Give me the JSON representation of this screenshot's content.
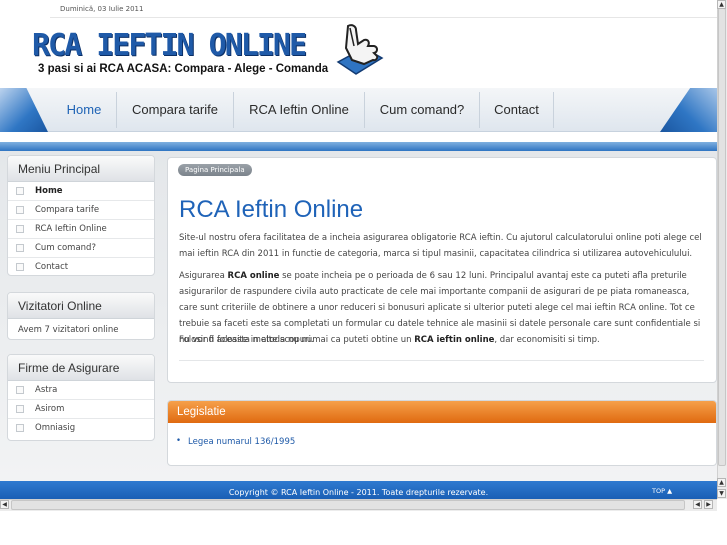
{
  "header": {
    "date": "Duminică, 03 Iulie 2011",
    "logo_title": "RCA IEFTIN ONLINE",
    "logo_subtitle": "3 pasi si ai RCA ACASA: Compara - Alege - Comanda"
  },
  "nav": {
    "items": [
      {
        "label": "Home",
        "active": true
      },
      {
        "label": "Compara tarife"
      },
      {
        "label": "RCA Ieftin Online"
      },
      {
        "label": "Cum comand?"
      },
      {
        "label": "Contact"
      }
    ]
  },
  "sidebar": {
    "menu": {
      "title": "Meniu Principal",
      "items": [
        "Home",
        "Compara tarife",
        "RCA Ieftin Online",
        "Cum comand?",
        "Contact"
      ]
    },
    "visitors": {
      "title": "Vizitatori Online",
      "text": "Avem 7 vizitatori online"
    },
    "insurers": {
      "title": "Firme de Asigurare",
      "items": [
        "Astra",
        "Asirom",
        "Omniasig"
      ]
    }
  },
  "content": {
    "breadcrumb": "Pagina Principala",
    "title": "RCA Ieftin Online",
    "p1": "Site-ul nostru ofera facilitatea de a incheia asigurarea obligatorie RCA ieftin. Cu ajutorul calculatorului online poti alege cel mai ieftin RCA din 2011 in functie de categoria, marca si tipul masinii, capacitatea cilindrica si utilizarea autovehiculului.",
    "p2_a": "Asigurarea ",
    "p2_b": "RCA online",
    "p2_c": " se poate incheia pe o perioada de 6 sau 12 luni. Principalul avantaj este ca puteti afla preturile asigurarilor de raspundere civila auto practicate de cele mai importante companii de asigurari de pe piata romaneasca, care sunt criteriile de obtinere a unor reduceri si bonusuri aplicate si ulterior puteti alege cel mai ieftin RCA online. Tot ce trebuie sa faceti este sa completati un formular cu datele tehnice ale masinii si datele personale care sunt confidentiale si nu vor fi folosite in alte scopuri.",
    "p3_a": "Folosind aceasta metoda nu numai ca puteti obtine un ",
    "p3_b": "RCA ieftin online",
    "p3_c": ", dar economisiti si timp."
  },
  "legislation": {
    "title": "Legislatie",
    "items": [
      "Legea numarul 136/1995"
    ]
  },
  "footer": {
    "copyright": "Copyright © RCA Ieftin Online - 2011. Toate drepturile rezervate.",
    "top_link": "TOP ▲"
  },
  "colors": {
    "brand_blue": "#1f63b8",
    "orange": "#e87820",
    "footer_blue": "#1f66bf"
  },
  "icons": {
    "logo": "pointing-hand-icon",
    "menu_bullet": "square-bullet-icon"
  }
}
